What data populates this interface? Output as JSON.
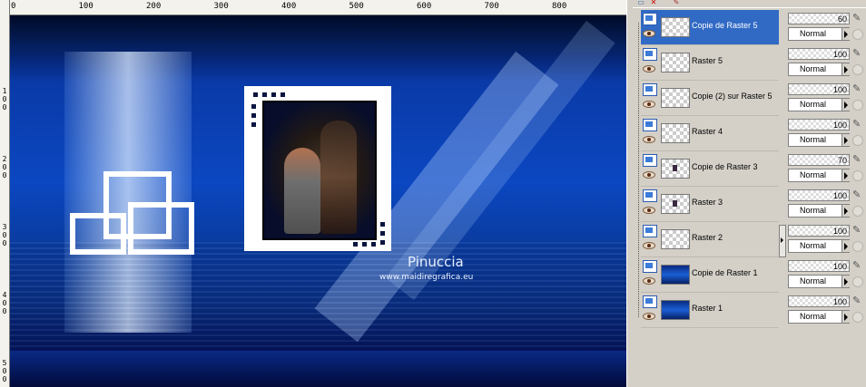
{
  "ruler": {
    "top_labels": [
      "0",
      "100",
      "200",
      "300",
      "400",
      "500",
      "600",
      "700",
      "800"
    ],
    "left_labels": [
      {
        "digits": [
          "1",
          "0",
          "0"
        ]
      },
      {
        "digits": [
          "2",
          "0",
          "0"
        ]
      },
      {
        "digits": [
          "3",
          "0",
          "0"
        ]
      },
      {
        "digits": [
          "4",
          "0",
          "0"
        ]
      },
      {
        "digits": [
          "5",
          "0",
          "0"
        ]
      }
    ]
  },
  "canvas": {
    "signature_name": "Pinuccia",
    "signature_url": "www.maidiregrafica.eu"
  },
  "toolbar": {
    "delete_icon": "✕",
    "brush_icon": "✎"
  },
  "layers": [
    {
      "name": "Copie de Raster 5",
      "selected": true,
      "thumb": "checker",
      "opacity": "60",
      "blend": "Normal"
    },
    {
      "name": "Raster 5",
      "selected": false,
      "thumb": "checker",
      "opacity": "100",
      "blend": "Normal"
    },
    {
      "name": "Copie (2) sur Raster 5",
      "selected": false,
      "thumb": "checker",
      "opacity": "100",
      "blend": "Normal"
    },
    {
      "name": "Raster 4",
      "selected": false,
      "thumb": "checker",
      "opacity": "100",
      "blend": "Normal"
    },
    {
      "name": "Copie de Raster 3",
      "selected": false,
      "thumb": "dot",
      "opacity": "70",
      "blend": "Normal"
    },
    {
      "name": "Raster 3",
      "selected": false,
      "thumb": "dot",
      "opacity": "100",
      "blend": "Normal"
    },
    {
      "name": "Raster 2",
      "selected": false,
      "thumb": "checker",
      "opacity": "100",
      "blend": "Normal"
    },
    {
      "name": "Copie de Raster 1",
      "selected": false,
      "thumb": "img",
      "opacity": "100",
      "blend": "Normal"
    },
    {
      "name": "Raster 1",
      "selected": false,
      "thumb": "img",
      "opacity": "100",
      "blend": "Normal"
    }
  ]
}
